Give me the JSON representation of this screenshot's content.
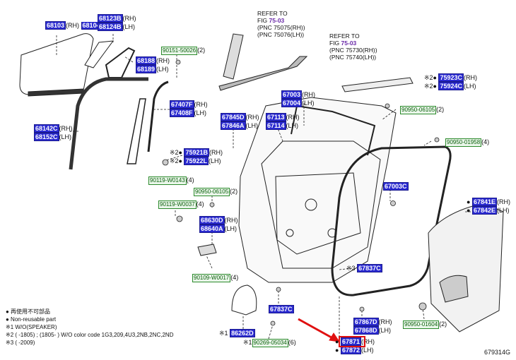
{
  "refs": [
    {
      "line1": "REFER TO",
      "fig_prefix": "FIG ",
      "fig": "75-03",
      "line3": "(PNC 75075(RH))",
      "line4": "(PNC 75076(LH))"
    },
    {
      "line1": "REFER TO",
      "fig_prefix": "FIG ",
      "fig": "75-03",
      "line3": "(PNC 75730(RH))",
      "line4": "(PNC 75740(LH))"
    }
  ],
  "parts": {
    "p68103": {
      "rh": "68103",
      "lh": "68104"
    },
    "p68123": {
      "rh": "68123B",
      "lh": "68124B"
    },
    "p68188": {
      "rh": "68188",
      "lh": "68189"
    },
    "p68142": {
      "rh": "68142C",
      "lh": "68152C"
    },
    "p67407": {
      "rh": "67407F",
      "lh": "67408F"
    },
    "p67845": {
      "rh": "67845D",
      "lh": "67846A"
    },
    "p67113": {
      "rh": "67113",
      "lh": "67114"
    },
    "p67003": {
      "rh": "67003",
      "lh": "67004"
    },
    "p75923": {
      "rh": "75923C",
      "lh": "75924C"
    },
    "p75921": {
      "rh": "75921B",
      "lh": "75922L"
    },
    "p68630": {
      "rh": "68630D",
      "lh": "68640A"
    },
    "p67003c": {
      "pn": "67003C"
    },
    "p67841": {
      "rh": "67841E",
      "lh": "67842E"
    },
    "p67837a": {
      "pn": "67837C"
    },
    "p67837b": {
      "pn": "67837C"
    },
    "p67867": {
      "rh": "67867D",
      "lh": "67868D"
    },
    "p86262": {
      "pn": "86262D"
    },
    "p67871": {
      "rh": "67871",
      "lh": "67872"
    }
  },
  "hardware": {
    "h90151": "90151-50026",
    "h90950a": "90950-06105",
    "h90950b": "90950-01958",
    "h90119a": "90119-W0143",
    "h90950c": "90950-06105",
    "h90119b": "90119-W0037",
    "h90109": "90109-W0017",
    "h90950d": "90950-01604",
    "h90269": "90269-05034"
  },
  "qty": {
    "q2": "(2)",
    "q4": "(4)",
    "q6": "(6)"
  },
  "sfx": {
    "rh": "(RH)",
    "lh": "(LH)"
  },
  "marks": {
    "x2": "※2",
    "x1": "※1",
    "x3": "※3"
  },
  "legend": {
    "l1": "● 再使用不可部品",
    "l2": "● Non-reusable part",
    "l3": "※1 W/O(SPEAKER)",
    "l4": "※2 (      -1805) ; (1805-      ) W/O color code 1G3,209,4U3,2NB,2NC,2ND",
    "l5": "※3 (      -2009)"
  },
  "figure_code": "679314G"
}
